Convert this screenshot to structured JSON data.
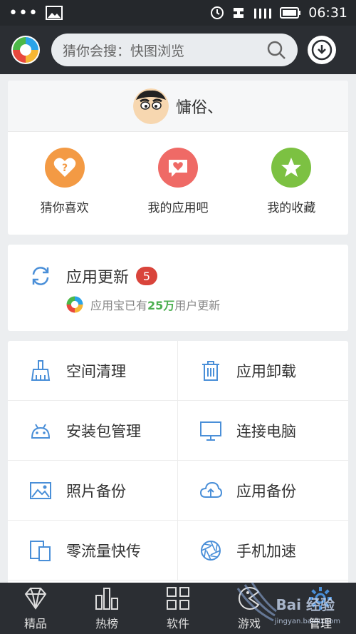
{
  "status": {
    "time": "06:31"
  },
  "search": {
    "placeholder": "猜你会搜：快图浏览"
  },
  "profile": {
    "username": "慵俗、"
  },
  "quick_actions": [
    {
      "label": "猜你喜欢",
      "icon": "question-heart-icon",
      "color": "#f39a44"
    },
    {
      "label": "我的应用吧",
      "icon": "chat-heart-icon",
      "color": "#ef6a66"
    },
    {
      "label": "我的收藏",
      "icon": "star-icon",
      "color": "#7cc142"
    }
  ],
  "update": {
    "title": "应用更新",
    "badge": "5",
    "sub_prefix": "应用宝已有",
    "sub_number": "25万",
    "sub_suffix": "用户更新"
  },
  "tools": [
    {
      "label": "空间清理",
      "icon": "broom-icon"
    },
    {
      "label": "应用卸载",
      "icon": "trash-icon"
    },
    {
      "label": "安装包管理",
      "icon": "android-icon"
    },
    {
      "label": "连接电脑",
      "icon": "monitor-icon"
    },
    {
      "label": "照片备份",
      "icon": "photo-icon"
    },
    {
      "label": "应用备份",
      "icon": "cloud-upload-icon"
    },
    {
      "label": "零流量快传",
      "icon": "devices-icon"
    },
    {
      "label": "手机加速",
      "icon": "aperture-icon"
    }
  ],
  "tabs": [
    {
      "label": "精品",
      "icon": "diamond-icon"
    },
    {
      "label": "热榜",
      "icon": "bars-icon"
    },
    {
      "label": "软件",
      "icon": "grid-icon"
    },
    {
      "label": "游戏",
      "icon": "pacman-icon"
    },
    {
      "label": "管理",
      "icon": "gear-icon"
    }
  ],
  "watermark": {
    "text": "Bai 经验",
    "sub": "jingyan.baidu.com"
  },
  "colors": {
    "icon_blue": "#4a8fd8",
    "accent_green": "#4caf50",
    "badge_red": "#d9443b"
  }
}
